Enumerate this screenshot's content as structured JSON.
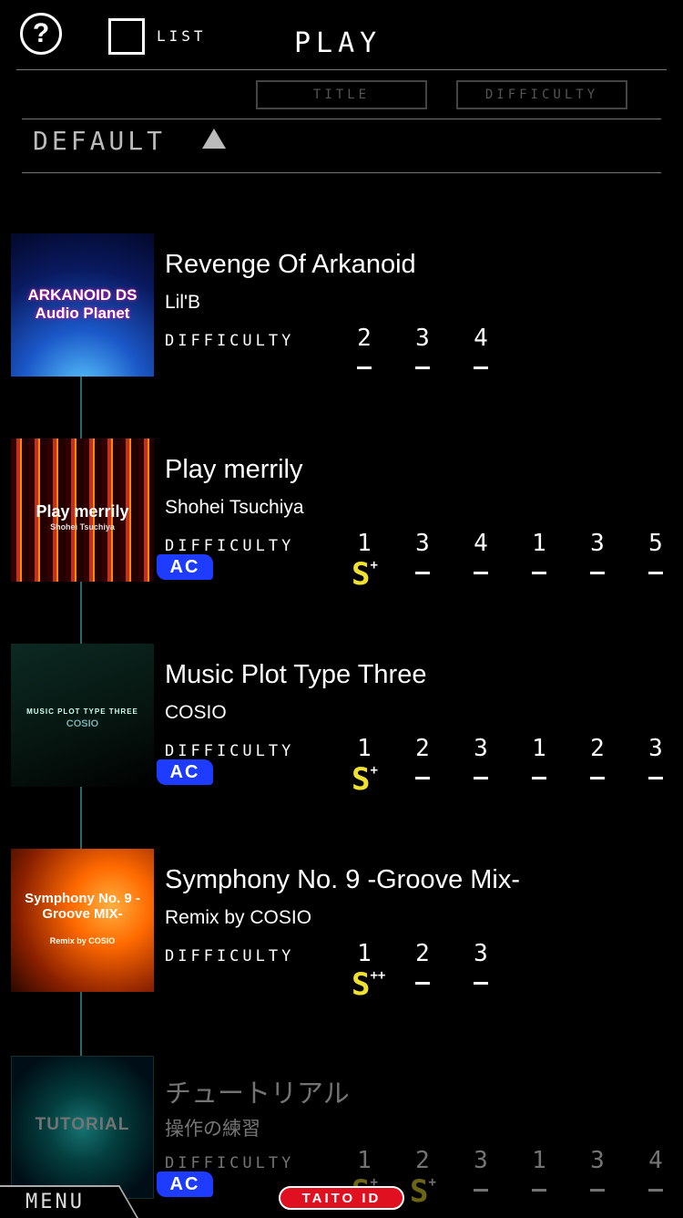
{
  "header": {
    "help_icon": "question-icon",
    "list_label": "LIST",
    "title": "PLAY"
  },
  "sort": {
    "title_button": "TITLE",
    "difficulty_button": "DIFFICULTY",
    "current": "DEFAULT",
    "direction_icon": "triangle-up-icon"
  },
  "songs": [
    {
      "title": "Revenge Of Arkanoid",
      "artist": "Lil'B",
      "difficulty_label": "DIFFICULTY",
      "jacket_text": "ARKANOID DS Audio Planet",
      "ac": false,
      "levels": [
        {
          "level": "2",
          "rank": "",
          "rank_plus": ""
        },
        {
          "level": "3",
          "rank": "",
          "rank_plus": ""
        },
        {
          "level": "4",
          "rank": "",
          "rank_plus": ""
        }
      ]
    },
    {
      "title": "Play merrily",
      "artist": "Shohei Tsuchiya",
      "difficulty_label": "DIFFICULTY",
      "jacket_text": "Play merrily",
      "jacket_sub": "Shohei Tsuchiya",
      "ac": true,
      "ac_label": "AC",
      "levels": [
        {
          "level": "1",
          "rank": "S",
          "rank_plus": "+"
        },
        {
          "level": "3",
          "rank": "",
          "rank_plus": ""
        },
        {
          "level": "4",
          "rank": "",
          "rank_plus": ""
        },
        {
          "level": "1",
          "rank": "",
          "rank_plus": ""
        },
        {
          "level": "3",
          "rank": "",
          "rank_plus": ""
        },
        {
          "level": "5",
          "rank": "",
          "rank_plus": ""
        }
      ]
    },
    {
      "title": "Music Plot Type Three",
      "artist": "COSIO",
      "difficulty_label": "DIFFICULTY",
      "jacket_text": "MUSIC PLOT TYPE THREE",
      "jacket_sub": "COSIO",
      "ac": true,
      "ac_label": "AC",
      "levels": [
        {
          "level": "1",
          "rank": "S",
          "rank_plus": "+"
        },
        {
          "level": "2",
          "rank": "",
          "rank_plus": ""
        },
        {
          "level": "3",
          "rank": "",
          "rank_plus": ""
        },
        {
          "level": "1",
          "rank": "",
          "rank_plus": ""
        },
        {
          "level": "2",
          "rank": "",
          "rank_plus": ""
        },
        {
          "level": "3",
          "rank": "",
          "rank_plus": ""
        }
      ]
    },
    {
      "title": "Symphony No. 9 -Groove Mix-",
      "artist": "Remix by COSIO",
      "difficulty_label": "DIFFICULTY",
      "jacket_text": "Symphony No. 9 -Groove MIX-",
      "jacket_sub": "Remix by COSIO",
      "ac": false,
      "levels": [
        {
          "level": "1",
          "rank": "S",
          "rank_plus": "++"
        },
        {
          "level": "2",
          "rank": "",
          "rank_plus": ""
        },
        {
          "level": "3",
          "rank": "",
          "rank_plus": ""
        }
      ]
    },
    {
      "title": "チュートリアル",
      "artist": "操作の練習",
      "difficulty_label": "DIFFICULTY",
      "jacket_text": "TUTORIAL",
      "ac": true,
      "ac_label": "AC",
      "levels": [
        {
          "level": "1",
          "rank": "S",
          "rank_plus": "+"
        },
        {
          "level": "2",
          "rank": "S",
          "rank_plus": "+"
        },
        {
          "level": "3",
          "rank": "",
          "rank_plus": ""
        },
        {
          "level": "1",
          "rank": "",
          "rank_plus": ""
        },
        {
          "level": "3",
          "rank": "",
          "rank_plus": ""
        },
        {
          "level": "4",
          "rank": "",
          "rank_plus": ""
        }
      ]
    }
  ],
  "footer": {
    "menu_label": "MENU",
    "taito_label": "TAITO ID"
  },
  "colors": {
    "ac_badge": "#1e3cff",
    "rank": "#f0e030",
    "taito": "#e01020",
    "timeline": "#2a6a6a"
  }
}
